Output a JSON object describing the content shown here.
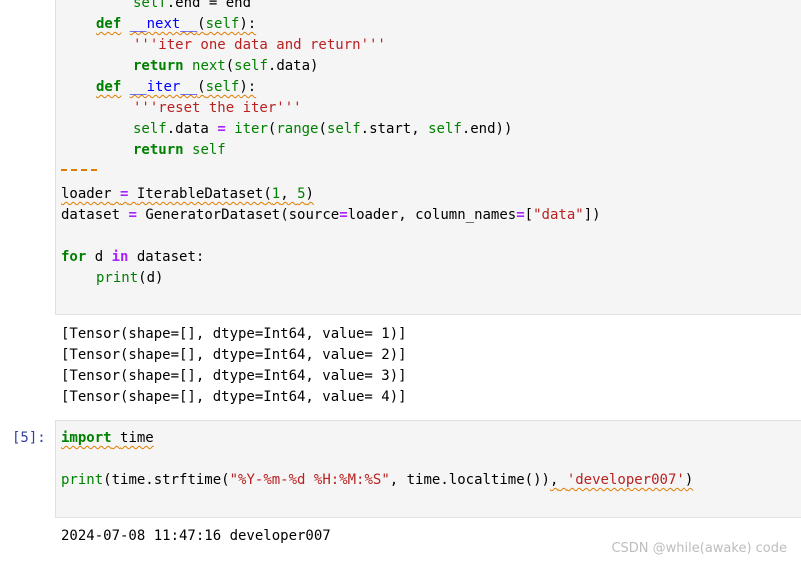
{
  "cell1": {
    "code": {
      "l0_self": "self",
      "l0_rest": ".end = end",
      "l1_def": "def",
      "l1_name": "__next__",
      "l1_self": "self",
      "l2_doc": "'''iter one data and return'''",
      "l3_return": "return",
      "l3_next": "next",
      "l3_self": "self",
      "l3_attr": ".data",
      "l4_def": "def",
      "l4_name": "__iter__",
      "l4_self": "self",
      "l5_doc": "'''reset the iter'''",
      "l6_self": "self",
      "l6_attr": ".data",
      "l6_eq": "=",
      "l6_iter": "iter",
      "l6_range": "range",
      "l6_self2": "self",
      "l6_start": ".start",
      "l6_self3": "self",
      "l6_end": ".end",
      "l7_return": "return",
      "l7_self": "self",
      "l9_loader": "loader",
      "l9_eq": "=",
      "l9_cls": "IterableDataset",
      "l9_n1": "1",
      "l9_n2": "5",
      "l10_dataset": "dataset",
      "l10_eq": "=",
      "l10_cls": "GeneratorDataset",
      "l10_source": "source",
      "l10_eq2": "=",
      "l10_loader": "loader",
      "l10_cols": "column_names",
      "l10_eq3": "=",
      "l10_str": "\"data\"",
      "l12_for": "for",
      "l12_d": " d ",
      "l12_in": "in",
      "l12_dataset": " dataset:",
      "l13_print": "print",
      "l13_d": "(d)"
    },
    "outputs": [
      "[Tensor(shape=[], dtype=Int64, value= 1)]",
      "[Tensor(shape=[], dtype=Int64, value= 2)]",
      "[Tensor(shape=[], dtype=Int64, value= 3)]",
      "[Tensor(shape=[], dtype=Int64, value= 4)]"
    ]
  },
  "cell2": {
    "prompt": "[5]:",
    "code": {
      "l0_import": "import",
      "l0_time": "time",
      "l2_print": "print",
      "l2_time": "(time.",
      "l2_strftime": "strftime",
      "l2_fmt": "\"%Y-%m-%d %H:%M:%S\"",
      "l2_time2": ", time.",
      "l2_localtime": "localtime",
      "l2_paren": "())",
      "l2_comma": ",",
      "l2_str2": "'developer007'",
      "l2_close": ")"
    },
    "output": "2024-07-08 11:47:16 developer007"
  },
  "watermark": "CSDN @while(awake) code"
}
